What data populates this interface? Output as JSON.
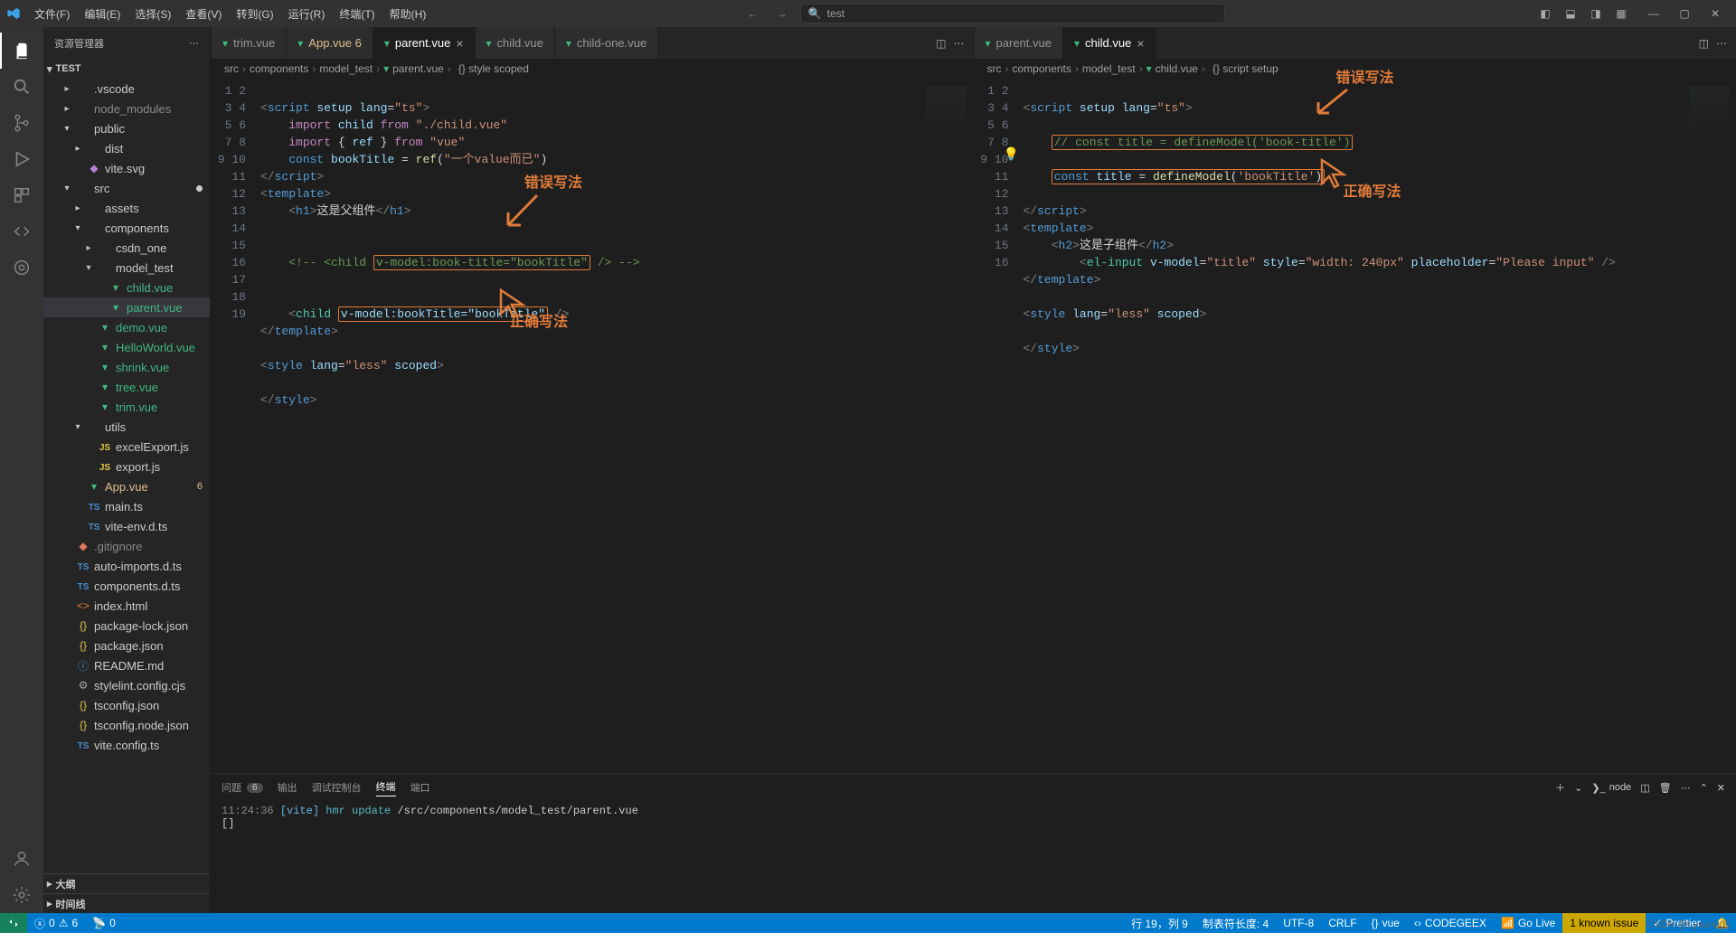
{
  "menu": {
    "file": "文件(F)",
    "edit": "编辑(E)",
    "select": "选择(S)",
    "view": "查看(V)",
    "go": "转到(G)",
    "run": "运行(R)",
    "terminal": "终端(T)",
    "help": "帮助(H)"
  },
  "titlebar": {
    "search_text": "test"
  },
  "sidebar": {
    "title": "资源管理器",
    "project": "TEST",
    "outline": "大纲",
    "timeline": "时间线",
    "tree": [
      {
        "depth": 1,
        "chev": "right",
        "icon": "folder",
        "name": ".vscode",
        "cls": ""
      },
      {
        "depth": 1,
        "chev": "right",
        "icon": "folder",
        "name": "node_modules",
        "cls": "dim"
      },
      {
        "depth": 1,
        "chev": "down",
        "icon": "folder",
        "name": "public",
        "cls": ""
      },
      {
        "depth": 2,
        "chev": "right",
        "icon": "folder",
        "name": "dist",
        "cls": ""
      },
      {
        "depth": 2,
        "chev": "",
        "icon": "svg",
        "name": "vite.svg",
        "cls": ""
      },
      {
        "depth": 1,
        "chev": "down",
        "icon": "folder",
        "name": "src",
        "cls": "",
        "dot": true
      },
      {
        "depth": 2,
        "chev": "right",
        "icon": "folder",
        "name": "assets",
        "cls": ""
      },
      {
        "depth": 2,
        "chev": "down",
        "icon": "folder",
        "name": "components",
        "cls": ""
      },
      {
        "depth": 3,
        "chev": "right",
        "icon": "folder",
        "name": "csdn_one",
        "cls": ""
      },
      {
        "depth": 3,
        "chev": "down",
        "icon": "folder",
        "name": "model_test",
        "cls": ""
      },
      {
        "depth": 4,
        "chev": "",
        "icon": "vue",
        "name": "child.vue",
        "cls": "vue"
      },
      {
        "depth": 4,
        "chev": "",
        "icon": "vue",
        "name": "parent.vue",
        "cls": "vue",
        "selected": true
      },
      {
        "depth": 3,
        "chev": "",
        "icon": "vue",
        "name": "demo.vue",
        "cls": "vue"
      },
      {
        "depth": 3,
        "chev": "",
        "icon": "vue",
        "name": "HelloWorld.vue",
        "cls": "vue"
      },
      {
        "depth": 3,
        "chev": "",
        "icon": "vue",
        "name": "shrink.vue",
        "cls": "vue"
      },
      {
        "depth": 3,
        "chev": "",
        "icon": "vue",
        "name": "tree.vue",
        "cls": "vue"
      },
      {
        "depth": 3,
        "chev": "",
        "icon": "vue",
        "name": "trim.vue",
        "cls": "vue"
      },
      {
        "depth": 2,
        "chev": "down",
        "icon": "folder",
        "name": "utils",
        "cls": ""
      },
      {
        "depth": 3,
        "chev": "",
        "icon": "js",
        "name": "excelExport.js",
        "cls": ""
      },
      {
        "depth": 3,
        "chev": "",
        "icon": "js",
        "name": "export.js",
        "cls": ""
      },
      {
        "depth": 2,
        "chev": "",
        "icon": "vue",
        "name": "App.vue",
        "cls": "modified",
        "badge": "6"
      },
      {
        "depth": 2,
        "chev": "",
        "icon": "ts",
        "name": "main.ts",
        "cls": ""
      },
      {
        "depth": 2,
        "chev": "",
        "icon": "ts",
        "name": "vite-env.d.ts",
        "cls": ""
      },
      {
        "depth": 1,
        "chev": "",
        "icon": "git",
        "name": ".gitignore",
        "cls": "dim"
      },
      {
        "depth": 1,
        "chev": "",
        "icon": "ts",
        "name": "auto-imports.d.ts",
        "cls": ""
      },
      {
        "depth": 1,
        "chev": "",
        "icon": "ts",
        "name": "components.d.ts",
        "cls": ""
      },
      {
        "depth": 1,
        "chev": "",
        "icon": "html",
        "name": "index.html",
        "cls": ""
      },
      {
        "depth": 1,
        "chev": "",
        "icon": "json",
        "name": "package-lock.json",
        "cls": ""
      },
      {
        "depth": 1,
        "chev": "",
        "icon": "json",
        "name": "package.json",
        "cls": ""
      },
      {
        "depth": 1,
        "chev": "",
        "icon": "md",
        "name": "README.md",
        "cls": ""
      },
      {
        "depth": 1,
        "chev": "",
        "icon": "gear",
        "name": "stylelint.config.cjs",
        "cls": ""
      },
      {
        "depth": 1,
        "chev": "",
        "icon": "json",
        "name": "tsconfig.json",
        "cls": ""
      },
      {
        "depth": 1,
        "chev": "",
        "icon": "json",
        "name": "tsconfig.node.json",
        "cls": ""
      },
      {
        "depth": 1,
        "chev": "",
        "icon": "ts",
        "name": "vite.config.ts",
        "cls": ""
      }
    ]
  },
  "tabsLeft": [
    {
      "name": "trim.vue",
      "active": false,
      "modified": false
    },
    {
      "name": "App.vue",
      "active": false,
      "modified": true,
      "badge": "6"
    },
    {
      "name": "parent.vue",
      "active": true,
      "modified": false,
      "close": true
    },
    {
      "name": "child.vue",
      "active": false,
      "modified": false
    },
    {
      "name": "child-one.vue",
      "active": false,
      "modified": false
    }
  ],
  "tabsRight": [
    {
      "name": "parent.vue",
      "active": false,
      "modified": false
    },
    {
      "name": "child.vue",
      "active": true,
      "modified": false,
      "close": true
    }
  ],
  "breadcrumbsLeft": [
    "src",
    "components",
    "model_test",
    "parent.vue",
    "{} style scoped"
  ],
  "breadcrumbsRight": [
    "src",
    "components",
    "model_test",
    "child.vue",
    "{} script setup"
  ],
  "annotations": {
    "wrong": "错误写法",
    "correct": "正确写法"
  },
  "codeLeft": {
    "lines": 19,
    "l1": {
      "a": "<",
      "b": "script",
      "c": " setup lang",
      "d": "=",
      "e": "\"ts\"",
      "f": ">"
    },
    "l2": {
      "a": "import ",
      "b": "child",
      "c": " from ",
      "d": "\"./child.vue\""
    },
    "l3": {
      "a": "import ",
      "b": "{ ",
      "c": "ref",
      "d": " } ",
      "e": "from ",
      "f": "\"vue\""
    },
    "l4": {
      "a": "const ",
      "b": "bookTitle",
      "c": " = ",
      "d": "ref",
      "e": "(",
      "f": "\"一个value而已\"",
      "g": ")"
    },
    "l5": {
      "a": "</",
      "b": "script",
      "c": ">"
    },
    "l6": {
      "a": "<",
      "b": "template",
      "c": ">"
    },
    "l7": {
      "a": "<",
      "b": "h1",
      "c": ">",
      "d": "这是父组件",
      "e": "</",
      "f": "h1",
      "g": ">"
    },
    "l10": {
      "a": "<!-- ",
      "b": "<",
      "c": "child",
      "d": " ",
      "box": "v-model:book-title=\"bookTitle\"",
      "e": " /> ",
      "f": "-->"
    },
    "l13": {
      "a": "<",
      "b": "child",
      "c": " ",
      "box": "v-model:bookTitle=\"bookTitle\"",
      "d": " />"
    },
    "l14": {
      "a": "</",
      "b": "template",
      "c": ">"
    },
    "l16": {
      "a": "<",
      "b": "style",
      "c": " lang",
      "d": "=",
      "e": "\"less\"",
      "f": " scoped",
      "g": ">"
    },
    "l18": {
      "a": "</",
      "b": "style",
      "c": ">"
    }
  },
  "codeRight": {
    "lines": 16,
    "l1": {
      "a": "<",
      "b": "script",
      "c": " setup lang",
      "d": "=",
      "e": "\"ts\"",
      "f": ">"
    },
    "l3": {
      "box": "// const title = defineModel('book-title')"
    },
    "l5": {
      "a": "const ",
      "b": "title",
      "c": " = ",
      "d": "defineModel",
      "e": "(",
      "f": "'bookTitle'",
      "g": ")"
    },
    "l7": {
      "a": "</",
      "b": "script",
      "c": ">"
    },
    "l8": {
      "a": "<",
      "b": "template",
      "c": ">"
    },
    "l9": {
      "a": "<",
      "b": "h2",
      "c": ">",
      "d": "这是子组件",
      "e": "</",
      "f": "h2",
      "g": ">"
    },
    "l10": {
      "a": "<",
      "b": "el-input",
      "c": " v-model",
      "d": "=",
      "e": "\"title\"",
      "f": " style",
      "g": "=",
      "h": "\"width: 240px\"",
      "i": " placeholder",
      "j": "=",
      "k": "\"Please input\"",
      "l": " />"
    },
    "l11": {
      "a": "</",
      "b": "template",
      "c": ">"
    },
    "l13": {
      "a": "<",
      "b": "style",
      "c": " lang",
      "d": "=",
      "e": "\"less\"",
      "f": " scoped",
      "g": ">"
    },
    "l15": {
      "a": "</",
      "b": "style",
      "c": ">"
    }
  },
  "panel": {
    "problems": "问题",
    "problems_count": "6",
    "output": "输出",
    "debug": "调试控制台",
    "terminal": "终端",
    "ports": "端口",
    "term_name": "node",
    "log_time": "11:24:36",
    "log_vite": "[vite]",
    "log_op": "hmr update",
    "log_path": "/src/components/model_test/parent.vue",
    "prompt": "[]"
  },
  "status": {
    "errors": "0",
    "warnings": "6",
    "ports": "0",
    "lncol": "行 19，列 9",
    "tabsize": "制表符长度: 4",
    "encoding": "UTF-8",
    "eol": "CRLF",
    "lang": "vue",
    "codegeex": "CODEGEEX",
    "golive": "Go Live",
    "issue": "1 known issue",
    "prettier": "Prettier"
  },
  "watermark": "CSDN @Lysun001"
}
